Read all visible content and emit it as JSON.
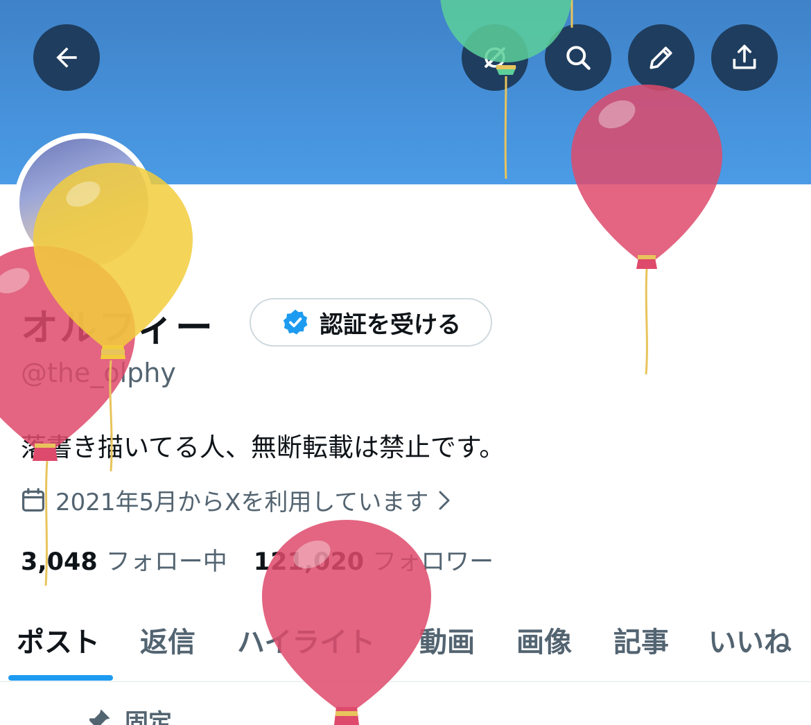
{
  "header": {
    "back_icon": "arrow-left-icon",
    "actions": [
      "grok-icon",
      "search-icon",
      "pencil-icon",
      "share-icon"
    ]
  },
  "profile": {
    "display_name": "オルフィー",
    "verify_label": "認証を受ける",
    "handle": "@the_olphy",
    "bio": "落書き描いてる人、無断転載は禁止です。",
    "joined": "2021年5月からXを利用しています",
    "following_count": "3,048",
    "following_label": "フォロー中",
    "followers_count": "121,020",
    "followers_label": "フォロワー"
  },
  "tabs": [
    "ポスト",
    "返信",
    "ハイライト",
    "動画",
    "画像",
    "記事",
    "いいね"
  ],
  "active_tab": "ポスト",
  "pinned_label": "固定",
  "colors": {
    "banner": "#4b9be6",
    "button_bg": "#1f3d5e",
    "accent": "#1d9bf0",
    "muted_text": "#536471"
  }
}
